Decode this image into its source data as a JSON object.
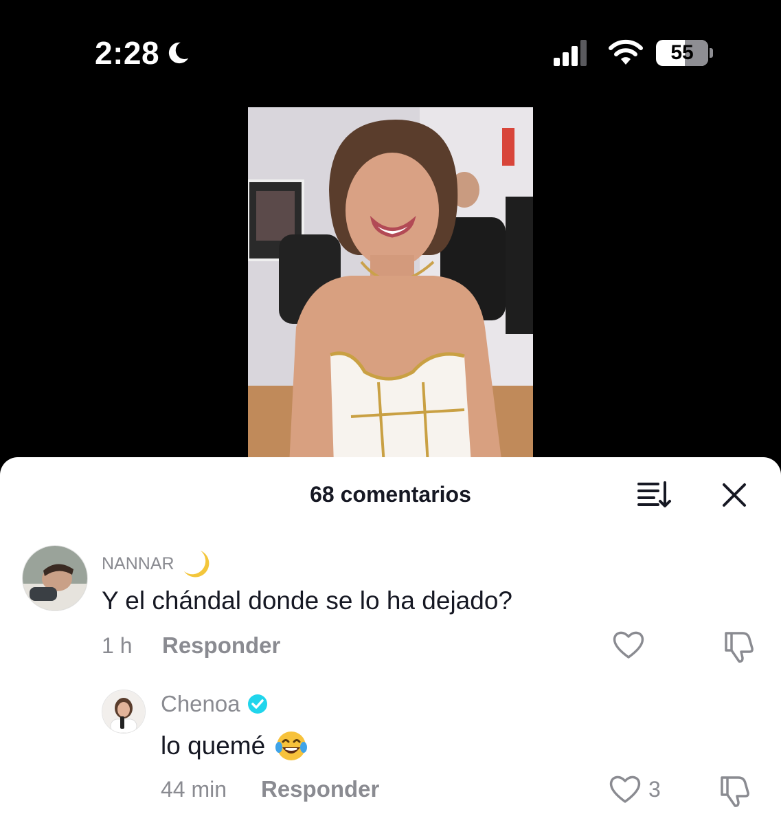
{
  "status_bar": {
    "time": "2:28",
    "battery_level": "55",
    "battery_fraction": 0.55
  },
  "sheet": {
    "title": "68 comentarios"
  },
  "comments": [
    {
      "username": "NANNAR",
      "username_emoji": "moon-emoji",
      "text": "Y el chándal donde se lo ha dejado?",
      "time": "1 h",
      "reply_label": "Responder"
    },
    {
      "username": "Chenoa",
      "verified": true,
      "text": "lo quemé",
      "text_emoji": "laughing-tears-emoji",
      "time": "44 min",
      "reply_label": "Responder",
      "like_count": "3"
    }
  ],
  "colors": {
    "verified_badge": "#20d5ec",
    "secondary_text": "#8a8b91",
    "primary_text": "#161823"
  }
}
